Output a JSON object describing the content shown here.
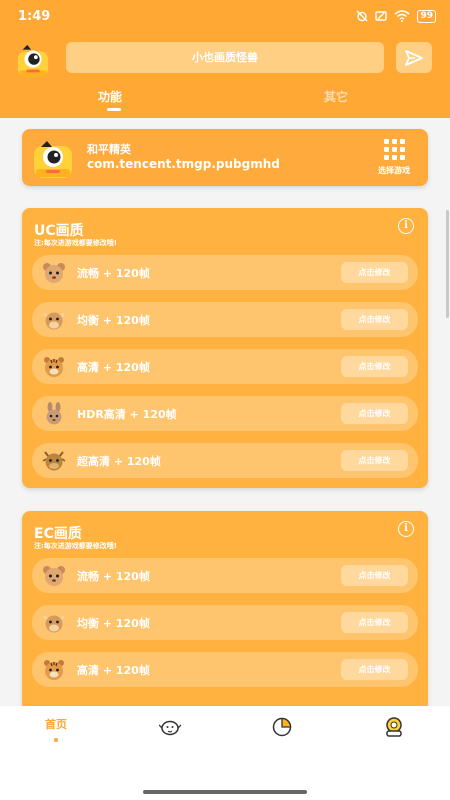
{
  "status_bar": {
    "time": "1:49",
    "battery": "99"
  },
  "header": {
    "search_label": "小也画质怪兽",
    "tabs": [
      {
        "label": "功能",
        "active": true
      },
      {
        "label": "其它",
        "active": false
      }
    ]
  },
  "game": {
    "title": "和平精英",
    "package": "com.tencent.tmgp.pubgmhd",
    "select_label": "选择游戏"
  },
  "uc_panel": {
    "title": "UC画质",
    "note": "注:每次进游戏都要修改哦!",
    "rows": [
      {
        "label": "流畅 + 120帧",
        "button": "点击修改",
        "icon": "mouse-icon"
      },
      {
        "label": "均衡 + 120帧",
        "button": "点击修改",
        "icon": "ox-icon"
      },
      {
        "label": "高清 + 120帧",
        "button": "点击修改",
        "icon": "tiger-icon"
      },
      {
        "label": "HDR高清 + 120帧",
        "button": "点击修改",
        "icon": "rabbit-icon"
      },
      {
        "label": "超高清 + 120帧",
        "button": "点击修改",
        "icon": "dragon-icon"
      }
    ]
  },
  "ec_panel": {
    "title": "EC画质",
    "note": "注:每次进游戏都要修改哦!",
    "rows": [
      {
        "label": "流畅 + 120帧",
        "button": "点击修改",
        "icon": "mouse-icon"
      },
      {
        "label": "均衡 + 120帧",
        "button": "点击修改",
        "icon": "ox-icon"
      },
      {
        "label": "高清 + 120帧",
        "button": "点击修改",
        "icon": "tiger-icon"
      }
    ]
  },
  "bottom_nav": {
    "home_label": "首页",
    "items": [
      "home",
      "bird-icon",
      "chart-icon",
      "profile-icon"
    ]
  },
  "colors": {
    "accent": "#ffa833",
    "card": "#ffb23f",
    "row": "#ffc56e",
    "row_button": "#ffd89d"
  }
}
